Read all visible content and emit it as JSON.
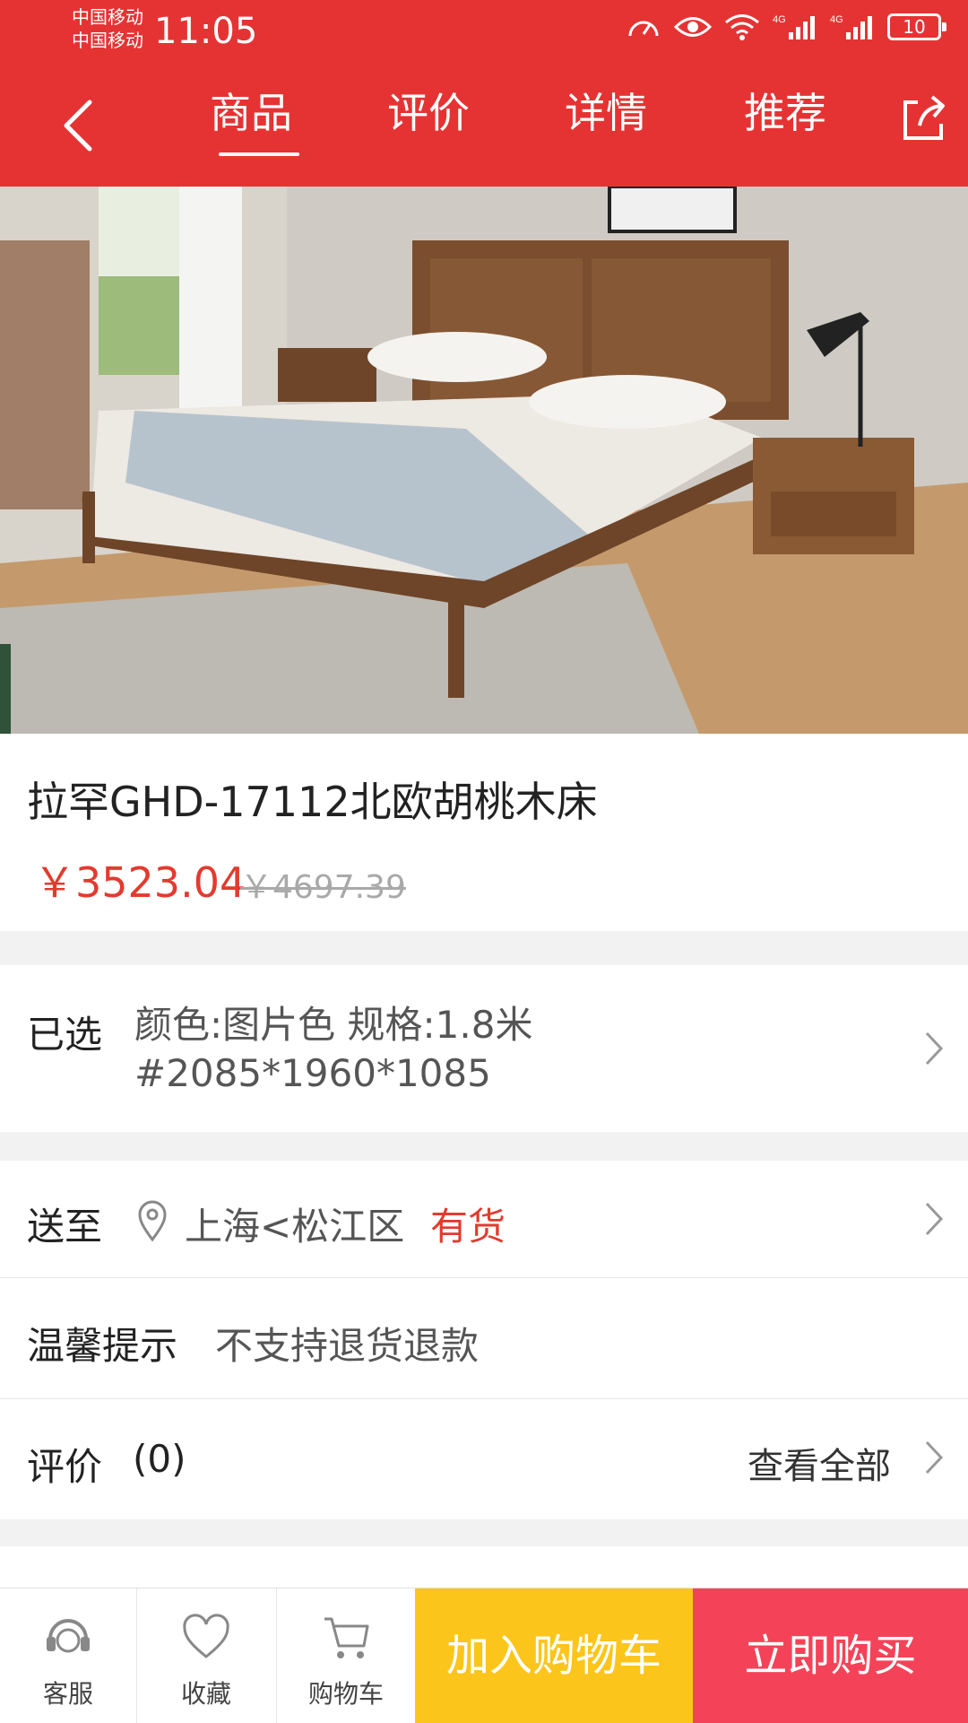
{
  "status_bar": {
    "carrier_1": "中国移动",
    "carrier_2": "中国移动",
    "time": "11:05",
    "battery": "10"
  },
  "nav": {
    "tabs": [
      {
        "label": "商品",
        "active": true
      },
      {
        "label": "评价",
        "active": false
      },
      {
        "label": "详情",
        "active": false
      },
      {
        "label": "推荐",
        "active": false
      }
    ],
    "icons": {
      "back": "back-arrow-icon",
      "share": "share-icon"
    }
  },
  "product": {
    "title": "拉罕GHD-17112北欧胡桃木床",
    "price": "￥3523.04",
    "original_price": "￥4697.39"
  },
  "selected": {
    "label": "已选",
    "line1": "颜色:图片色 规格:1.8米",
    "line2": "#2085*1960*1085"
  },
  "delivery": {
    "label": "送至",
    "location": "上海<松江区",
    "stock": "有货"
  },
  "tip": {
    "label": "温馨提示",
    "text": "不支持退货退款"
  },
  "reviews": {
    "label": "评价",
    "count": "(0)",
    "view_all": "查看全部"
  },
  "bottom_bar": {
    "service": "客服",
    "favorite": "收藏",
    "cart": "购物车",
    "add_to_cart": "加入购物车",
    "buy_now": "立即购买"
  },
  "colors": {
    "brand_red": "#e53333",
    "price_red": "#e23b2e",
    "cart_yellow": "#fcc51b",
    "buy_pink": "#f44358"
  }
}
